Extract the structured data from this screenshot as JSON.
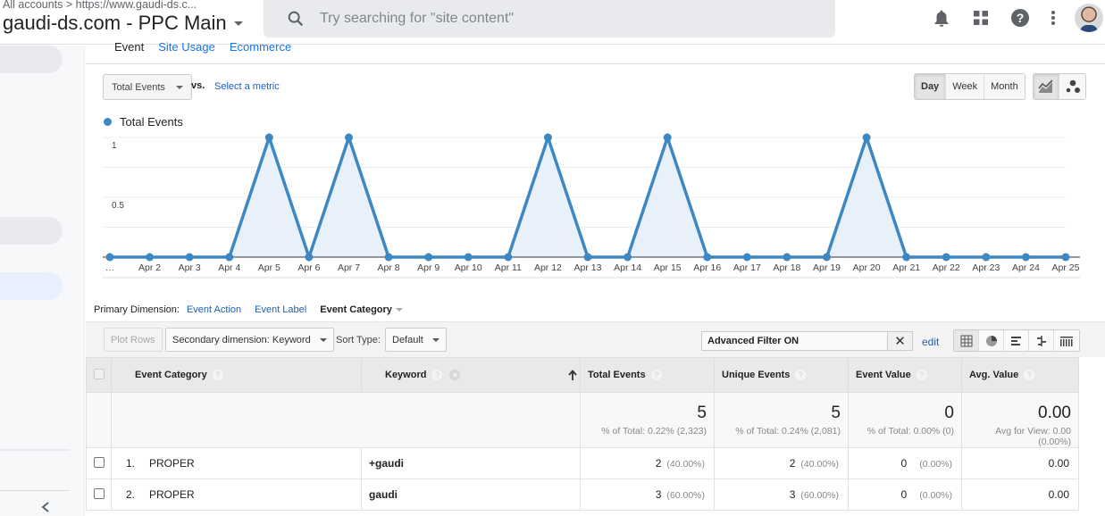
{
  "header": {
    "breadcrumb": "All accounts > https://www.gaudi-ds.c...",
    "property_title": "gaudi-ds.com - PPC Main",
    "search_placeholder": "Try searching for \"site content\"",
    "icons": [
      "bell-icon",
      "apps-grid-icon",
      "help-icon",
      "more-vert-icon",
      "avatar"
    ]
  },
  "subtabs": {
    "active": "Event",
    "items": [
      "Site Usage",
      "Ecommerce"
    ]
  },
  "chart_controls": {
    "metric": "Total Events",
    "vs": "vs.",
    "select_metric": "Select a metric",
    "granularity": [
      {
        "label": "Day",
        "active": true
      },
      {
        "label": "Week",
        "active": false
      },
      {
        "label": "Month",
        "active": false
      }
    ],
    "chart_types": [
      {
        "icon": "line-chart-icon",
        "active": true
      },
      {
        "icon": "motion-chart-icon",
        "active": false
      }
    ]
  },
  "colors": {
    "series": "#3d88c2",
    "fill": "#e8f1f9",
    "link": "#1e5fb4"
  },
  "chart_data": {
    "type": "area",
    "title": "",
    "legend": [
      "Total Events"
    ],
    "legend_position": "top-left",
    "x": [
      "…",
      "Apr 2",
      "Apr 3",
      "Apr 4",
      "Apr 5",
      "Apr 6",
      "Apr 7",
      "Apr 8",
      "Apr 9",
      "Apr 10",
      "Apr 11",
      "Apr 12",
      "Apr 13",
      "Apr 14",
      "Apr 15",
      "Apr 16",
      "Apr 17",
      "Apr 18",
      "Apr 19",
      "Apr 20",
      "Apr 21",
      "Apr 22",
      "Apr 23",
      "Apr 24",
      "Apr 25"
    ],
    "series": [
      {
        "name": "Total Events",
        "values": [
          0,
          0,
          0,
          0,
          1,
          0,
          1,
          0,
          0,
          0,
          0,
          1,
          0,
          0,
          1,
          0,
          0,
          0,
          0,
          1,
          0,
          0,
          0,
          0,
          0
        ]
      }
    ],
    "ylim": [
      0,
      1
    ],
    "yticks": [
      {
        "value": 1,
        "label": "1"
      },
      {
        "value": 0.5,
        "label": "0.5"
      }
    ],
    "gridlines": [
      0.25,
      0.5,
      0.75,
      1
    ],
    "grid": true,
    "xlabel": "",
    "ylabel": ""
  },
  "primary_dimension": {
    "label": "Primary Dimension:",
    "options": [
      "Event Action",
      "Event Label"
    ],
    "current": "Event Category"
  },
  "toolbar": {
    "plot_rows": "Plot Rows",
    "secondary_dimension": "Secondary dimension: Keyword",
    "sort_type_label": "Sort Type:",
    "sort_type_value": "Default",
    "filter_value": "Advanced Filter ON",
    "clear": "✕",
    "edit": "edit",
    "view_icons": [
      "table-view-icon",
      "pie-view-icon",
      "performance-view-icon",
      "comparison-view-icon",
      "pivot-view-icon"
    ]
  },
  "table": {
    "columns": [
      "Event Category",
      "Keyword",
      "Total Events",
      "Unique Events",
      "Event Value",
      "Avg. Value"
    ],
    "totals": [
      {
        "value": "5",
        "sub": "% of Total: 0.22% (2,323)"
      },
      {
        "value": "5",
        "sub": "% of Total: 0.24% (2,081)"
      },
      {
        "value": "0",
        "sub": "% of Total: 0.00% (0)"
      },
      {
        "value": "0.00",
        "sub": "Avg for View: 0.00 (0.00%)"
      }
    ],
    "rows": [
      {
        "index": "1.",
        "category": "PROPER",
        "keyword": "+gaudi",
        "total_events": "2",
        "total_pct": "(40.00%)",
        "unique_events": "2",
        "unique_pct": "(40.00%)",
        "event_value": "0",
        "value_pct": "(0.00%)",
        "avg_value": "0.00"
      },
      {
        "index": "2.",
        "category": "PROPER",
        "keyword": "gaudi",
        "total_events": "3",
        "total_pct": "(60.00%)",
        "unique_events": "3",
        "unique_pct": "(60.00%)",
        "event_value": "0",
        "value_pct": "(0.00%)",
        "avg_value": "0.00"
      }
    ]
  }
}
